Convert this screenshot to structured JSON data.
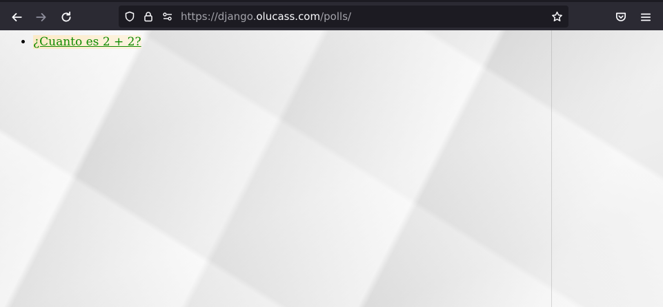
{
  "browser": {
    "back_icon": "arrow-left-icon",
    "forward_icon": "arrow-right-icon",
    "reload_icon": "reload-icon",
    "shield_icon": "shield-icon",
    "lock_icon": "lock-icon",
    "permissions_icon": "permissions-icon",
    "bookmark_icon": "star-icon",
    "pocket_icon": "pocket-icon",
    "menu_icon": "hamburger-menu-icon",
    "url": {
      "scheme": "https://",
      "subdomain": "django.",
      "domain": "olucass.com",
      "path": "/polls/"
    }
  },
  "page": {
    "polls": [
      {
        "question": "¿Cuanto es 2 + 2?"
      }
    ]
  },
  "colors": {
    "link": "#0f8a00",
    "toolbar": "#2b2a33",
    "urlbar": "#1c1b22"
  }
}
